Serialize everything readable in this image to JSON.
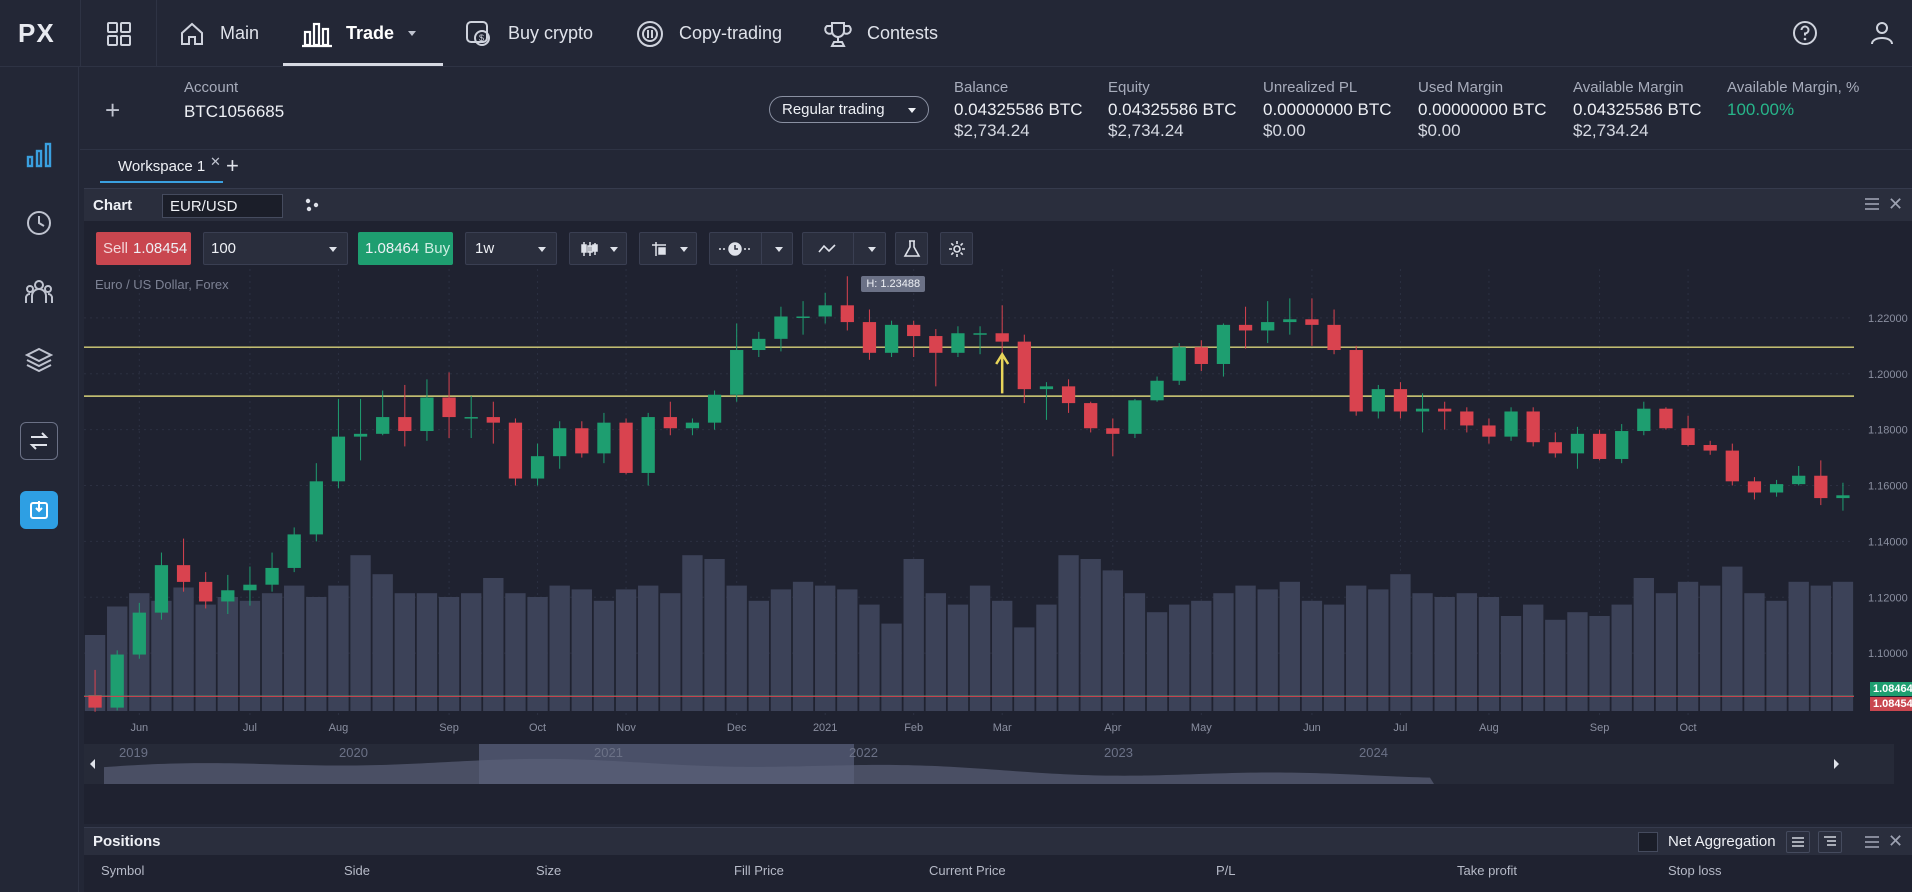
{
  "logo": "PX",
  "nav": {
    "items": [
      {
        "label": "Main",
        "icon": "home-icon"
      },
      {
        "label": "Trade",
        "icon": "bar-chart-icon"
      },
      {
        "label": "Buy crypto",
        "icon": "buy-crypto-icon"
      },
      {
        "label": "Copy-trading",
        "icon": "copy-trading-icon"
      },
      {
        "label": "Contests",
        "icon": "trophy-icon"
      }
    ]
  },
  "account": {
    "label": "Account",
    "id": "BTC1056685",
    "mode": "Regular trading",
    "stats": [
      {
        "label": "Balance",
        "value": "0.04325586 BTC",
        "usd": "$2,734.24"
      },
      {
        "label": "Equity",
        "value": "0.04325586 BTC",
        "usd": "$2,734.24"
      },
      {
        "label": "Unrealized PL",
        "value": "0.00000000 BTC",
        "usd": "$0.00"
      },
      {
        "label": "Used Margin",
        "value": "0.00000000 BTC",
        "usd": "$0.00"
      },
      {
        "label": "Available Margin",
        "value": "0.04325586 BTC",
        "usd": "$2,734.24"
      },
      {
        "label": "Available Margin, %",
        "value": "100.00%",
        "usd": ""
      }
    ],
    "percent_color": "#27b58a"
  },
  "workspace": {
    "tab": "Workspace 1",
    "add": "+"
  },
  "chart_panel": {
    "title": "Chart",
    "symbol": "EUR/USD",
    "sell_label": "Sell",
    "sell_price": "1.08454",
    "quantity": "100",
    "buy_price": "1.08464",
    "buy_label": "Buy",
    "interval": "1w",
    "instrument_desc": "Euro / US Dollar, Forex",
    "high_label": "H: 1.23488",
    "buy_badge": "1.08464",
    "sell_badge": "1.08454",
    "sell_color": "#c9464f",
    "buy_color": "#1e9e70"
  },
  "chart_data": {
    "type": "candlestick",
    "y_ticks": [
      "1.22000",
      "1.20000",
      "1.18000",
      "1.16000",
      "1.14000",
      "1.12000",
      "1.10000"
    ],
    "y_tick_values": [
      1.22,
      1.2,
      1.18,
      1.16,
      1.14,
      1.12,
      1.1
    ],
    "ylim": [
      1.0775,
      1.2375
    ],
    "x_ticks": [
      "Jun",
      "Jul",
      "Aug",
      "Sep",
      "Oct",
      "Nov",
      "Dec",
      "2021",
      "Feb",
      "Mar",
      "Apr",
      "May",
      "Jun",
      "Jul",
      "Aug",
      "Sep",
      "Oct"
    ],
    "x_tick_index": [
      2,
      7,
      11,
      16,
      20,
      24,
      29,
      33,
      37,
      41,
      46,
      50,
      55,
      59,
      63,
      68,
      72
    ],
    "horizontal_lines": [
      1.2095,
      1.192
    ],
    "current_price_lines": [
      1.08464,
      1.08454
    ],
    "candles": [
      [
        1.085,
        1.0805,
        1.079,
        1.094
      ],
      [
        1.0805,
        1.0995,
        1.0795,
        1.101
      ],
      [
        1.0995,
        1.1145,
        1.098,
        1.118
      ],
      [
        1.1145,
        1.1315,
        1.112,
        1.136
      ],
      [
        1.1315,
        1.1255,
        1.122,
        1.141
      ],
      [
        1.1255,
        1.1185,
        1.116,
        1.129
      ],
      [
        1.1185,
        1.1225,
        1.114,
        1.128
      ],
      [
        1.1225,
        1.1245,
        1.117,
        1.131
      ],
      [
        1.1245,
        1.1305,
        1.122,
        1.136
      ],
      [
        1.1305,
        1.1425,
        1.129,
        1.145
      ],
      [
        1.1425,
        1.1615,
        1.14,
        1.168
      ],
      [
        1.1615,
        1.1775,
        1.159,
        1.191
      ],
      [
        1.1775,
        1.1785,
        1.169,
        1.191
      ],
      [
        1.1785,
        1.1845,
        1.178,
        1.194
      ],
      [
        1.1845,
        1.1795,
        1.174,
        1.196
      ],
      [
        1.1795,
        1.1915,
        1.176,
        1.198
      ],
      [
        1.1915,
        1.1845,
        1.177,
        1.2005
      ],
      [
        1.1845,
        1.1845,
        1.177,
        1.192
      ],
      [
        1.1845,
        1.1825,
        1.175,
        1.19
      ],
      [
        1.1825,
        1.1625,
        1.16,
        1.184
      ],
      [
        1.1625,
        1.1705,
        1.16,
        1.175
      ],
      [
        1.1705,
        1.1805,
        1.166,
        1.183
      ],
      [
        1.1805,
        1.1715,
        1.17,
        1.183
      ],
      [
        1.1715,
        1.1825,
        1.168,
        1.186
      ],
      [
        1.1825,
        1.1645,
        1.164,
        1.184
      ],
      [
        1.1645,
        1.1845,
        1.16,
        1.186
      ],
      [
        1.1845,
        1.1805,
        1.178,
        1.19
      ],
      [
        1.1805,
        1.1825,
        1.178,
        1.184
      ],
      [
        1.1825,
        1.1925,
        1.18,
        1.194
      ],
      [
        1.1925,
        1.2085,
        1.19,
        1.218
      ],
      [
        1.2085,
        1.2125,
        1.206,
        1.215
      ],
      [
        1.2125,
        1.2205,
        1.208,
        1.224
      ],
      [
        1.2205,
        1.2205,
        1.214,
        1.226
      ],
      [
        1.2205,
        1.2245,
        1.218,
        1.229
      ],
      [
        1.2245,
        1.2185,
        1.2155,
        1.2349
      ],
      [
        1.2185,
        1.2075,
        1.205,
        1.223
      ],
      [
        1.2075,
        1.2175,
        1.206,
        1.219
      ],
      [
        1.2175,
        1.2135,
        1.206,
        1.219
      ],
      [
        1.2135,
        1.2075,
        1.1955,
        1.216
      ],
      [
        1.2075,
        1.2145,
        1.206,
        1.217
      ],
      [
        1.2145,
        1.2145,
        1.207,
        1.217
      ],
      [
        1.2145,
        1.2115,
        1.206,
        1.2245
      ],
      [
        1.2115,
        1.1945,
        1.1895,
        1.214
      ],
      [
        1.1945,
        1.1955,
        1.1835,
        1.197
      ],
      [
        1.1955,
        1.1895,
        1.186,
        1.198
      ],
      [
        1.1895,
        1.1805,
        1.179,
        1.19
      ],
      [
        1.1805,
        1.1785,
        1.1705,
        1.184
      ],
      [
        1.1785,
        1.1905,
        1.177,
        1.191
      ],
      [
        1.1905,
        1.1975,
        1.19,
        1.199
      ],
      [
        1.1975,
        1.2095,
        1.196,
        1.211
      ],
      [
        1.2095,
        1.2035,
        1.201,
        1.212
      ],
      [
        1.2035,
        1.2175,
        1.199,
        1.218
      ],
      [
        1.2175,
        1.2155,
        1.209,
        1.224
      ],
      [
        1.2155,
        1.2185,
        1.211,
        1.226
      ],
      [
        1.2185,
        1.2195,
        1.214,
        1.227
      ],
      [
        1.2195,
        1.2175,
        1.21,
        1.227
      ],
      [
        1.2175,
        1.2085,
        1.207,
        1.223
      ],
      [
        1.2085,
        1.1865,
        1.185,
        1.21
      ],
      [
        1.1865,
        1.1945,
        1.184,
        1.196
      ],
      [
        1.1945,
        1.1865,
        1.184,
        1.197
      ],
      [
        1.1865,
        1.1875,
        1.179,
        1.193
      ],
      [
        1.1875,
        1.1865,
        1.18,
        1.19
      ],
      [
        1.1865,
        1.1815,
        1.179,
        1.188
      ],
      [
        1.1815,
        1.1775,
        1.175,
        1.184
      ],
      [
        1.1775,
        1.1865,
        1.176,
        1.188
      ],
      [
        1.1865,
        1.1755,
        1.174,
        1.188
      ],
      [
        1.1755,
        1.1715,
        1.17,
        1.179
      ],
      [
        1.1715,
        1.1785,
        1.166,
        1.181
      ],
      [
        1.1785,
        1.1695,
        1.169,
        1.18
      ],
      [
        1.1695,
        1.1795,
        1.168,
        1.182
      ],
      [
        1.1795,
        1.1875,
        1.178,
        1.19
      ],
      [
        1.1875,
        1.1805,
        1.18,
        1.188
      ],
      [
        1.1805,
        1.1745,
        1.174,
        1.185
      ],
      [
        1.1745,
        1.1725,
        1.171,
        1.176
      ],
      [
        1.1725,
        1.1615,
        1.16,
        1.175
      ],
      [
        1.1615,
        1.1575,
        1.155,
        1.163
      ],
      [
        1.1575,
        1.1605,
        1.156,
        1.162
      ],
      [
        1.1605,
        1.1635,
        1.16,
        1.167
      ],
      [
        1.1635,
        1.1555,
        1.153,
        1.169
      ],
      [
        1.1555,
        1.1565,
        1.151,
        1.161
      ]
    ],
    "volume": [
      40,
      55,
      62,
      58,
      65,
      56,
      60,
      58,
      62,
      66,
      60,
      66,
      82,
      72,
      62,
      62,
      60,
      62,
      70,
      62,
      60,
      66,
      64,
      58,
      64,
      66,
      62,
      82,
      80,
      66,
      58,
      64,
      68,
      66,
      64,
      56,
      46,
      80,
      62,
      56,
      66,
      58,
      44,
      56,
      82,
      80,
      74,
      62,
      52,
      56,
      58,
      62,
      66,
      64,
      68,
      58,
      56,
      66,
      64,
      72,
      62,
      60,
      62,
      60,
      50,
      56,
      48,
      52,
      50,
      56,
      70,
      62,
      68,
      66,
      76,
      62,
      58,
      68,
      66,
      68
    ],
    "navigator_years": [
      "2019",
      "2020",
      "2021",
      "2022",
      "2023",
      "2024"
    ]
  },
  "positions": {
    "title": "Positions",
    "net_aggregation": "Net Aggregation",
    "columns": [
      "Symbol",
      "Side",
      "Size",
      "Fill Price",
      "Current Price",
      "P/L",
      "Take profit",
      "Stop loss"
    ]
  }
}
